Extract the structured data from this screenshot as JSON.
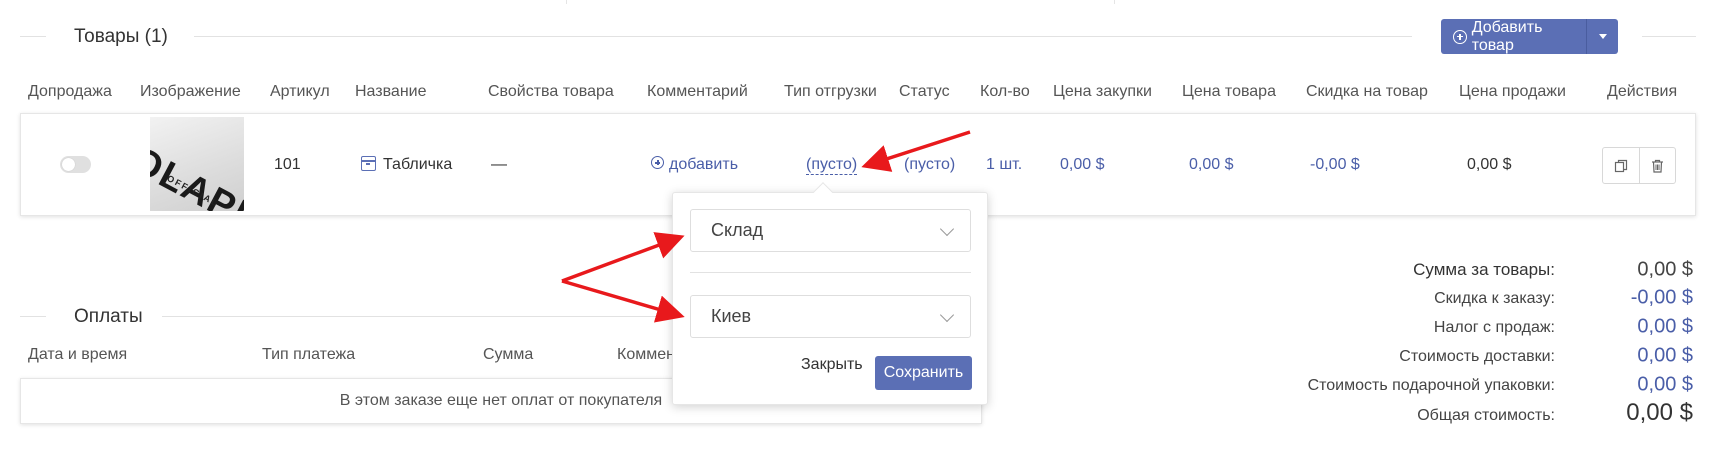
{
  "products_section": {
    "title": "Товары (1)",
    "add_button": "Добавить товар",
    "columns": [
      "Допродажа",
      "Изображение",
      "Артикул",
      "Название",
      "Свойства товара",
      "Комментарий",
      "Тип отгрузки",
      "Статус",
      "Кол-во",
      "Цена закупки",
      "Цена товара",
      "Скидка на товар",
      "Цена продажи",
      "Действия"
    ],
    "row": {
      "upsell_enabled": false,
      "image_text": "OLAPLEX",
      "image_subtext": "OFFICIAL",
      "sku": "101",
      "name": "Табличка",
      "properties": "—",
      "comment": "добавить",
      "shipment_type": "(пусто)",
      "status": "(пусто)",
      "quantity": "1 шт.",
      "purchase_price": "0,00 $",
      "product_price": "0,00 $",
      "discount": "-0,00 $",
      "sale_price": "0,00 $"
    }
  },
  "popover": {
    "select1": "Склад",
    "select2": "Киев",
    "close_label": "Закрыть",
    "save_label": "Сохранить"
  },
  "payments_section": {
    "title": "Оплаты",
    "columns": [
      "Дата и время",
      "Тип платежа",
      "Сумма",
      "Коммен"
    ],
    "empty_text": "В этом заказе еще нет оплат от покупателя"
  },
  "summary": {
    "items": [
      {
        "label": "Сумма за товары:",
        "value": "0,00 $"
      },
      {
        "label": "Скидка к заказу:",
        "value": "-0,00 $"
      },
      {
        "label": "Налог с продаж:",
        "value": "0,00 $"
      },
      {
        "label": "Стоимость доставки:",
        "value": "0,00 $"
      },
      {
        "label": "Стоимость подарочной упаковки:",
        "value": "0,00 $"
      },
      {
        "label": "Общая стоимость:",
        "value": "0,00 $"
      }
    ]
  },
  "colors": {
    "accent": "#5b6fb5",
    "link": "#4a5ea8",
    "arrow": "#e8191c"
  }
}
